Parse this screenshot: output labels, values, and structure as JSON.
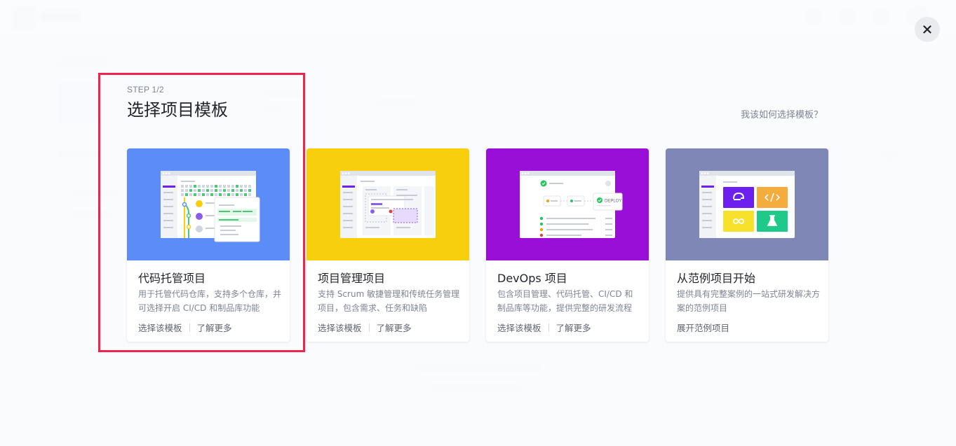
{
  "modal": {
    "step": "STEP 1/2",
    "title": "选择项目模板",
    "help_link": "我该如何选择模板？",
    "close_icon": "close-icon"
  },
  "templates": [
    {
      "title": "代码托管项目",
      "desc": "用于托管代码仓库，支持多个仓库，并可选择开启 CI/CD 和制品库功能",
      "action1": "选择该模板",
      "action2": "了解更多",
      "color": "#5b8cf7"
    },
    {
      "title": "项目管理项目",
      "desc": "支持 Scrum 敏捷管理和传统任务管理项目，包含需求、任务和缺陷",
      "action1": "选择该模板",
      "action2": "了解更多",
      "color": "#f7cf0d"
    },
    {
      "title": "DevOps 项目",
      "desc": "包含项目管理、代码托管、CI/CD 和制品库等功能，提供完整的研发流程",
      "action1": "选择该模板",
      "action2": "了解更多",
      "color": "#9a0fd8",
      "badge": "DEPLOY"
    },
    {
      "title": "从范例项目开始",
      "desc": "提供具有完整案例的一站式研发解决方案的范例项目",
      "action1": "展开范例项目",
      "color": "#7e87b6"
    }
  ],
  "colors": {
    "highlight": "#f0244a",
    "accent_purple": "#6d1ff0",
    "accent_green": "#22c55e"
  }
}
